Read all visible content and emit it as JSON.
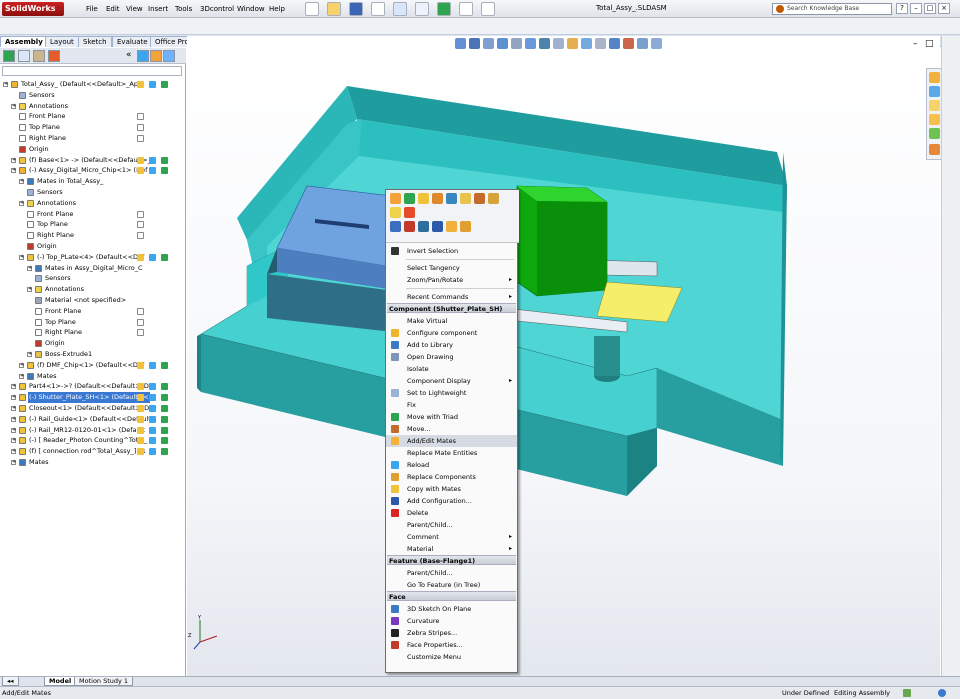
{
  "app": {
    "logo": "SolidWorks",
    "window_title": "Total_Assy_.SLDASM",
    "menus": [
      "File",
      "Edit",
      "View",
      "Insert",
      "Tools",
      "3Dcontrol",
      "Window",
      "Help"
    ],
    "search_placeholder": "Search Knowledge Base"
  },
  "command_tabs": [
    "Assembly",
    "Layout",
    "Sketch",
    "Evaluate",
    "Office Products"
  ],
  "feature_tree": [
    {
      "label": "Total_Assy_ (Default<<Default>_Ap",
      "depth": 0,
      "icon": "assembly-icon"
    },
    {
      "label": "Sensors",
      "depth": 1,
      "icon": "sensors-icon"
    },
    {
      "label": "Annotations",
      "depth": 1,
      "icon": "annotations-icon"
    },
    {
      "label": "Front Plane",
      "depth": 1,
      "icon": "plane-icon"
    },
    {
      "label": "Top Plane",
      "depth": 1,
      "icon": "plane-icon"
    },
    {
      "label": "Right Plane",
      "depth": 1,
      "icon": "plane-icon"
    },
    {
      "label": "Origin",
      "depth": 1,
      "icon": "origin-icon"
    },
    {
      "label": "(f) Base<1> -> (Default<<Default>_",
      "depth": 1,
      "icon": "part-icon"
    },
    {
      "label": "(-) Assy_Digital_Micro_Chip<1> (Def",
      "depth": 1,
      "icon": "assembly-icon"
    },
    {
      "label": "Mates in Total_Assy_",
      "depth": 2,
      "icon": "mates-icon"
    },
    {
      "label": "Sensors",
      "depth": 2,
      "icon": "sensors-icon"
    },
    {
      "label": "Annotations",
      "depth": 2,
      "icon": "annotations-icon"
    },
    {
      "label": "Front Plane",
      "depth": 2,
      "icon": "plane-icon"
    },
    {
      "label": "Top Plane",
      "depth": 2,
      "icon": "plane-icon"
    },
    {
      "label": "Right Plane",
      "depth": 2,
      "icon": "plane-icon"
    },
    {
      "label": "Origin",
      "depth": 2,
      "icon": "origin-icon"
    },
    {
      "label": "(-) Top_PLate<4> (Default<<Def",
      "depth": 2,
      "icon": "part-icon"
    },
    {
      "label": "Mates in Assy_Digital_Micro_C",
      "depth": 3,
      "icon": "mates-icon"
    },
    {
      "label": "Sensors",
      "depth": 3,
      "icon": "sensors-icon"
    },
    {
      "label": "Annotations",
      "depth": 3,
      "icon": "annotations-icon"
    },
    {
      "label": "Material <not specified>",
      "depth": 3,
      "icon": "material-icon"
    },
    {
      "label": "Front Plane",
      "depth": 3,
      "icon": "plane-icon"
    },
    {
      "label": "Top Plane",
      "depth": 3,
      "icon": "plane-icon"
    },
    {
      "label": "Right Plane",
      "depth": 3,
      "icon": "plane-icon"
    },
    {
      "label": "Origin",
      "depth": 3,
      "icon": "origin-icon"
    },
    {
      "label": "Boss-Extrude1",
      "depth": 3,
      "icon": "extrude-icon"
    },
    {
      "label": "(f) DMF_Chip<1> (Default<<Def",
      "depth": 2,
      "icon": "part-icon"
    },
    {
      "label": "Mates",
      "depth": 2,
      "icon": "mates-icon"
    },
    {
      "label": "Part4<1>->? (Default<<Default>_Di",
      "depth": 1,
      "icon": "part-icon"
    },
    {
      "label": "(-) Shutter_Plate_SH<1> (Default<<",
      "depth": 1,
      "icon": "part-icon",
      "selected": true
    },
    {
      "label": "Closeout<1> (Default<<Default>_Di",
      "depth": 1,
      "icon": "part-icon"
    },
    {
      "label": "(-) Rail_Guide<1> (Default<<Default",
      "depth": 1,
      "icon": "part-icon"
    },
    {
      "label": "(-) Rail_MR12-0120-01<1> (Default",
      "depth": 1,
      "icon": "part-icon"
    },
    {
      "label": "(-) [ Reader_Photon Counting^Total_",
      "depth": 1,
      "icon": "part-icon"
    },
    {
      "label": "(f) [ connection rod^Total_Assy_]<1",
      "depth": 1,
      "icon": "part-icon"
    },
    {
      "label": "Mates",
      "depth": 1,
      "icon": "mates-icon"
    }
  ],
  "context_menu": {
    "general": [
      {
        "label": "Invert Selection",
        "icon": "cursor-icon"
      },
      {
        "label": "Select Tangency"
      },
      {
        "label": "Zoom/Pan/Rotate",
        "submenu": true
      },
      {
        "label": "Recent Commands",
        "submenu": true
      }
    ],
    "component_header": "Component (Shutter_Plate_SH)",
    "component": [
      {
        "label": "Make Virtual"
      },
      {
        "label": "Configure component",
        "icon": "configure-icon"
      },
      {
        "label": "Add to Library",
        "icon": "library-icon"
      },
      {
        "label": "Open Drawing",
        "icon": "drawing-icon"
      },
      {
        "label": "Isolate"
      },
      {
        "label": "Component Display",
        "submenu": true
      },
      {
        "label": "Set to Lightweight",
        "icon": "lightweight-icon"
      },
      {
        "label": "Fix"
      },
      {
        "label": "Move with Triad",
        "icon": "triad-icon"
      },
      {
        "label": "Move...",
        "icon": "move-icon"
      },
      {
        "label": "Add/Edit Mates",
        "icon": "mate-icon",
        "highlighted": true
      },
      {
        "label": "Replace Mate Entities"
      },
      {
        "label": "Reload",
        "icon": "reload-icon"
      },
      {
        "label": "Replace Components",
        "icon": "replace-icon"
      },
      {
        "label": "Copy with Mates",
        "icon": "copy-icon"
      },
      {
        "label": "Add Configuration...",
        "icon": "add-config-icon"
      },
      {
        "label": "Delete",
        "icon": "delete-icon"
      },
      {
        "label": "Parent/Child..."
      },
      {
        "label": "Comment",
        "submenu": true
      },
      {
        "label": "Material",
        "submenu": true
      }
    ],
    "feature_header": "Feature (Base-Flange1)",
    "feature": [
      {
        "label": "Parent/Child..."
      },
      {
        "label": "Go To Feature (in Tree)"
      }
    ],
    "face_header": "Face",
    "face": [
      {
        "label": "3D Sketch On Plane",
        "icon": "sketch3d-icon"
      },
      {
        "label": "Curvature",
        "icon": "curvature-icon"
      },
      {
        "label": "Zebra Stripes...",
        "icon": "zebra-icon"
      },
      {
        "label": "Face Properties...",
        "icon": "face-props-icon"
      },
      {
        "label": "Customize Menu"
      }
    ]
  },
  "bottom_tabs": [
    "Model",
    "Motion Study 1"
  ],
  "status": {
    "left": "Add/Edit Mates",
    "mode": "Under Defined",
    "context": "Editing Assembly"
  },
  "colors": {
    "box": "#2fc7c7",
    "box_dark": "#1d8f91",
    "plate_blue": "#6fa3e0",
    "chip_green": "#0da80d",
    "yellow": "#f4ee6a",
    "selection": "#3b78d2"
  }
}
